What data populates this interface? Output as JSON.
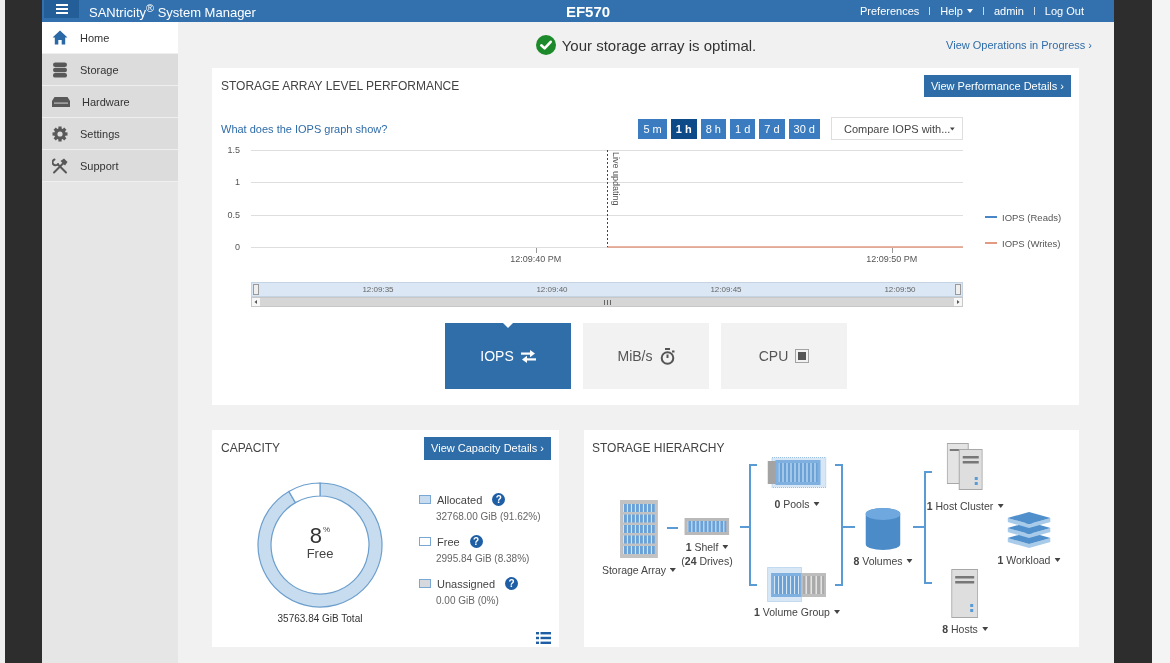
{
  "top_bar": {
    "title": "SANtricity$^{®}$ System Manager",
    "array_name": "EF570",
    "links": [
      {
        "label": "Preferences",
        "menu": false
      },
      {
        "label": "Help",
        "menu": true
      },
      {
        "label": "admin",
        "menu": false
      },
      {
        "label": "Log Out",
        "menu": false
      }
    ]
  },
  "sidebar": {
    "items": [
      {
        "label": "Home",
        "selected": true
      },
      {
        "label": "Storage",
        "selected": false
      },
      {
        "label": "Hardware",
        "selected": false
      },
      {
        "label": "Settings",
        "selected": false
      },
      {
        "label": "Support",
        "selected": false
      }
    ]
  },
  "status": {
    "message": "Your storage array is optimal.",
    "link": "View Operations in Progress ›"
  },
  "performance": {
    "title": "STORAGE ARRAY LEVEL PERFORMANCE",
    "details_button": "View Performance Details ›",
    "help_link": "What does the IOPS graph show?",
    "ranges": [
      {
        "label": "5 m",
        "selected": false
      },
      {
        "label": "1 h",
        "selected": true
      },
      {
        "label": "8 h",
        "selected": false
      },
      {
        "label": "1 d",
        "selected": false
      },
      {
        "label": "7 d",
        "selected": false
      },
      {
        "label": "30 d",
        "selected": false
      }
    ],
    "compare_select": {
      "value": "Compare IOPS with..."
    },
    "chart_data": {
      "type": "line",
      "legend": "right",
      "categories": [
        null,
        null,
        null,
        null,
        "12:09:40 PM",
        null,
        null,
        null,
        null,
        "12:09:50 PM",
        null
      ],
      "ylim": [
        0,
        1.5
      ],
      "yticks": [
        0,
        0.5,
        1,
        1.5
      ],
      "series": [
        {
          "name": "IOPS (Reads)",
          "color": "#4a86c5",
          "values": [
            null,
            null,
            null,
            null,
            null,
            null,
            null,
            null,
            null,
            null,
            null
          ]
        },
        {
          "name": "IOPS (Writes)",
          "color": "#e39a82",
          "values": [
            null,
            null,
            null,
            null,
            null,
            0,
            0,
            0,
            0,
            0,
            0
          ]
        }
      ],
      "annotations": [
        "Live updating"
      ]
    },
    "navigator": {
      "labels": [
        "12:09:35",
        "12:09:40",
        "12:09:45",
        "12:09:50"
      ]
    },
    "metrics": [
      {
        "label": "IOPS",
        "selected": true
      },
      {
        "label": "MiB/s",
        "selected": false
      },
      {
        "label": "CPU",
        "selected": false
      }
    ]
  },
  "capacity": {
    "title": "CAPACITY",
    "details_button": "View Capacity Details ›",
    "chart_data": {
      "type": "donut",
      "legend": "right",
      "categories": [
        "Allocated",
        "Free",
        "Unassigned"
      ],
      "values": [
        91.62,
        8.38,
        0
      ]
    },
    "center": {
      "value": "8",
      "unit": "%",
      "label": "Free"
    },
    "total": "35763.84 GiB Total",
    "legend": [
      {
        "amount": "32768.00 GiB (91.62%)",
        "color": "#c7dcef",
        "help": "?"
      },
      {
        "amount": "2995.84 GiB (8.38%)",
        "color": "#ffffff",
        "help": "?"
      },
      {
        "amount": "0.00 GiB (0%)",
        "color": "#d5d9dd",
        "help": "?"
      }
    ]
  },
  "hierarchy": {
    "title": "STORAGE HIERARCHY",
    "nodes": [
      {
        "kind": "array",
        "label": "Storage Array",
        "menu": true
      },
      {
        "kind": "shelf",
        "label": "**1** Shelf",
        "sublabel": "(**24** Drives)",
        "menu": true
      },
      {
        "kind": "pools",
        "label": "**0** Pools",
        "menu": true
      },
      {
        "kind": "volume_group",
        "label": "**1** Volume Group",
        "menu": true
      },
      {
        "kind": "volumes",
        "label": "**8** Volumes",
        "menu": true
      },
      {
        "kind": "host_cluster",
        "label": "**1** Host Cluster",
        "menu": true
      },
      {
        "kind": "hosts",
        "label": "**8** Hosts",
        "menu": true
      },
      {
        "kind": "workload",
        "label": "**1** Workload",
        "menu": true
      }
    ]
  }
}
